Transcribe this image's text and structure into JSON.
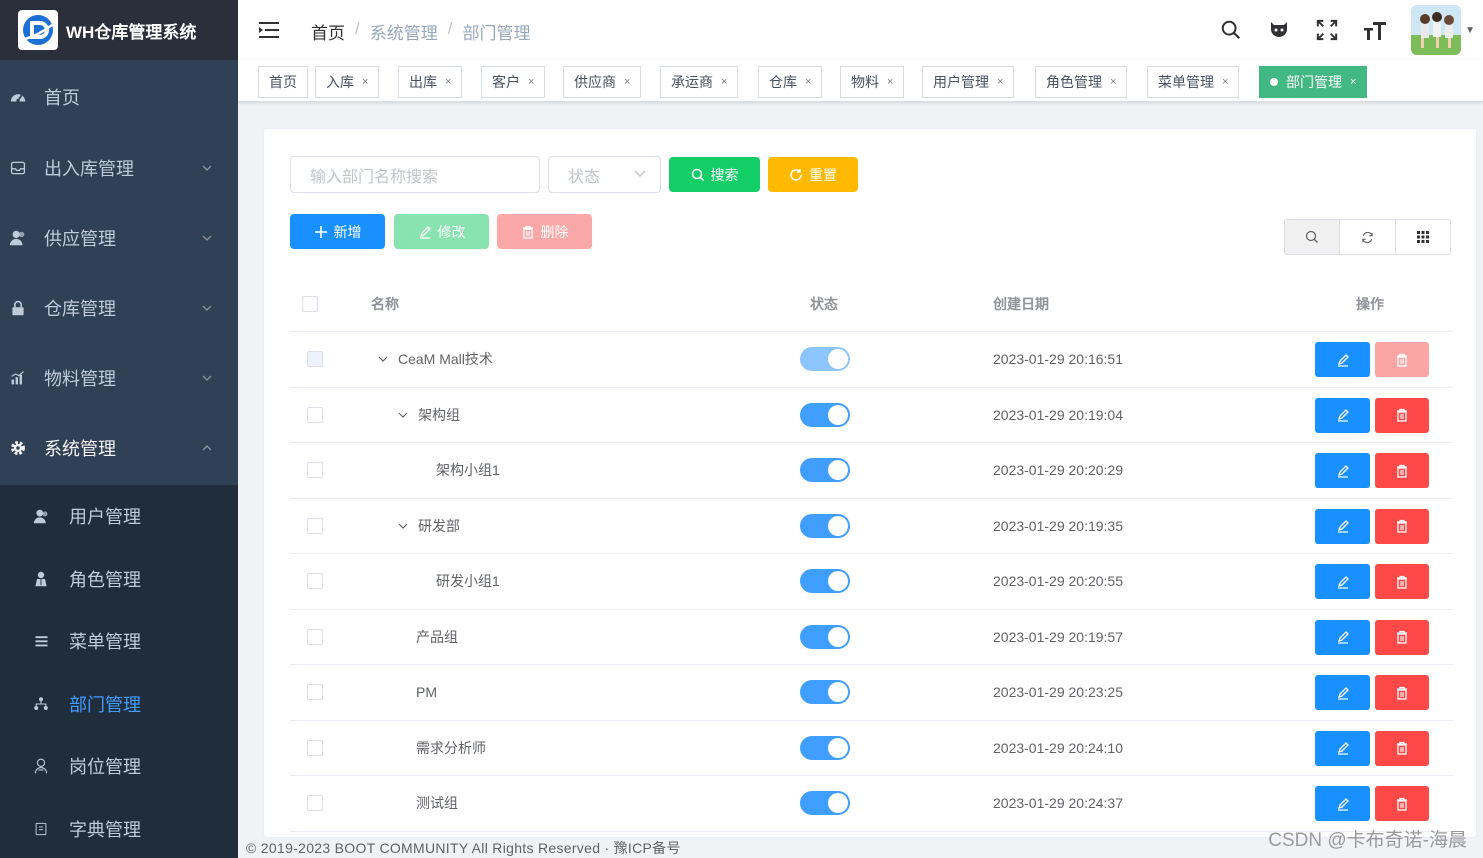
{
  "app": {
    "title": "WH仓库管理系统"
  },
  "sidebar": {
    "items": [
      {
        "label": "首页",
        "icon": "dashboard-icon"
      },
      {
        "label": "出入库管理",
        "icon": "inbox-icon"
      },
      {
        "label": "供应管理",
        "icon": "user-icon"
      },
      {
        "label": "仓库管理",
        "icon": "lock-icon"
      },
      {
        "label": "物料管理",
        "icon": "chart-icon"
      },
      {
        "label": "系统管理",
        "icon": "gear-icon"
      }
    ],
    "submenu": [
      {
        "label": "用户管理",
        "icon": "user-icon"
      },
      {
        "label": "角色管理",
        "icon": "role-icon"
      },
      {
        "label": "菜单管理",
        "icon": "list-icon"
      },
      {
        "label": "部门管理",
        "icon": "tree-icon"
      },
      {
        "label": "岗位管理",
        "icon": "post-icon"
      },
      {
        "label": "字典管理",
        "icon": "dict-icon"
      }
    ]
  },
  "breadcrumb": {
    "home": "首页",
    "sep": "/",
    "level1": "系统管理",
    "level2": "部门管理"
  },
  "tags": {
    "items": [
      "首页",
      "入库",
      "出库",
      "客户",
      "供应商",
      "承运商",
      "仓库",
      "物料",
      "用户管理",
      "角色管理",
      "菜单管理",
      "部门管理"
    ],
    "close": "×"
  },
  "toolbar": {
    "search_placeholder": "输入部门名称搜索",
    "status_placeholder": "状态",
    "search_label": "搜索",
    "reset_label": "重置",
    "add_label": "新增",
    "edit_label": "修改",
    "delete_label": "删除"
  },
  "table": {
    "headers": {
      "name": "名称",
      "status": "状态",
      "created": "创建日期",
      "ops": "操作"
    },
    "rows": [
      {
        "name": "CeaM Mall技术",
        "created": "2023-01-29 20:16:51",
        "status_on": true
      },
      {
        "name": "架构组",
        "created": "2023-01-29 20:19:04",
        "status_on": true
      },
      {
        "name": "架构小组1",
        "created": "2023-01-29 20:20:29",
        "status_on": true
      },
      {
        "name": "研发部",
        "created": "2023-01-29 20:19:35",
        "status_on": true
      },
      {
        "name": "研发小组1",
        "created": "2023-01-29 20:20:55",
        "status_on": true
      },
      {
        "name": "产品组",
        "created": "2023-01-29 20:19:57",
        "status_on": true
      },
      {
        "name": "PM",
        "created": "2023-01-29 20:23:25",
        "status_on": true
      },
      {
        "name": "需求分析师",
        "created": "2023-01-29 20:24:10",
        "status_on": true
      },
      {
        "name": "测试组",
        "created": "2023-01-29 20:24:37",
        "status_on": true
      }
    ]
  },
  "footer": {
    "text": "© 2019-2023 BOOT COMMUNITY All Rights Reserved · 豫ICP备号"
  },
  "watermark": {
    "text": "CSDN @卡布奇诺-海晨"
  },
  "colors": {
    "sidebar": "#304156",
    "primary": "#1890ff",
    "success": "#13ce66",
    "warning": "#ffba00",
    "danger": "#ff4949",
    "active_tag": "#42b983"
  }
}
